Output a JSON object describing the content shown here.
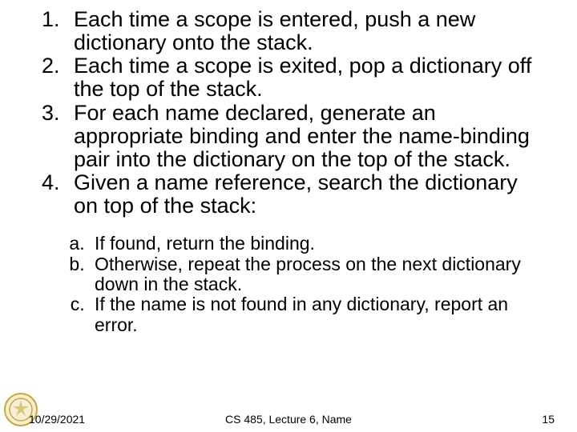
{
  "list": {
    "items": [
      "Each time a scope is entered, push a new dictionary onto the stack.",
      "Each time a scope is exited, pop a dictionary off the top of the stack.",
      "For each name declared, generate an appropriate binding and enter the name-binding pair into the dictionary on the top of the stack.",
      "Given a name reference, search the dictionary on top of the stack:"
    ],
    "subitems": [
      "If found, return the binding.",
      "Otherwise, repeat the process on the next dictionary down in the stack.",
      "If the name is not found in any dictionary, report an error."
    ]
  },
  "footer": {
    "date": "10/29/2021",
    "center": "CS 485, Lecture 6, Name",
    "pagenum": "15"
  }
}
